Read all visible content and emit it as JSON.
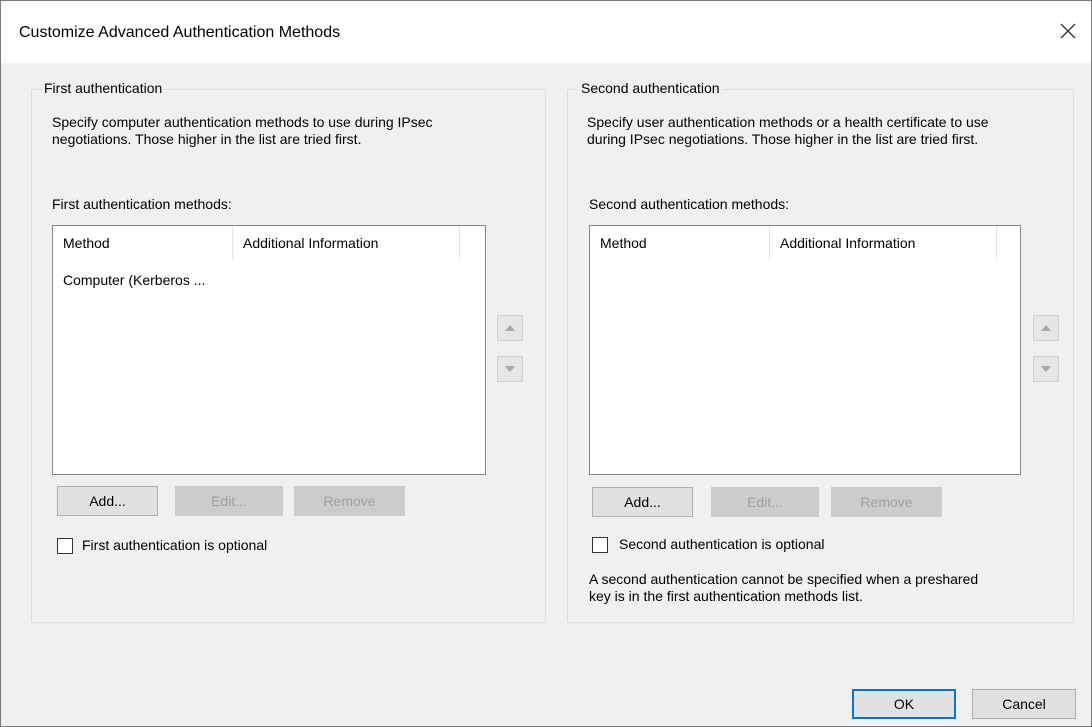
{
  "window": {
    "title": "Customize Advanced Authentication Methods",
    "close_icon": "close-icon"
  },
  "first": {
    "legend": "First authentication",
    "description_line1": "Specify computer authentication methods to use during IPsec",
    "description_line2": "negotiations.  Those higher in the list are tried first.",
    "list_label": "First authentication methods:",
    "columns": [
      "Method",
      "Additional Information"
    ],
    "rows": [
      {
        "method": "Computer (Kerberos ...",
        "info": ""
      }
    ],
    "buttons": {
      "add": "Add...",
      "edit": "Edit...",
      "remove": "Remove"
    },
    "optional_label": "First authentication is optional",
    "optional_checked": false
  },
  "second": {
    "legend": "Second authentication",
    "description_line1": "Specify user authentication methods or a health certificate to use",
    "description_line2": "during IPsec negotiations.  Those higher in the list are tried first.",
    "list_label": "Second authentication methods:",
    "columns": [
      "Method",
      "Additional Information"
    ],
    "rows": [],
    "buttons": {
      "add": "Add...",
      "edit": "Edit...",
      "remove": "Remove"
    },
    "optional_label": "Second authentication is optional",
    "optional_checked": false,
    "note_line1": "A second authentication cannot be specified when a preshared",
    "note_line2": "key is in the first authentication methods list."
  },
  "footer": {
    "ok": "OK",
    "cancel": "Cancel"
  },
  "colors": {
    "accent": "#0078d7",
    "disabled": "#cccccc",
    "background": "#f0f0f0"
  }
}
